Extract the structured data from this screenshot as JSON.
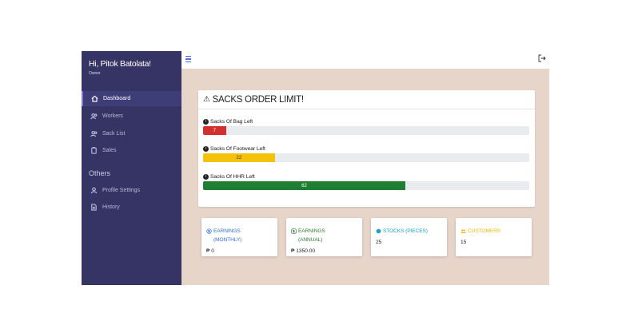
{
  "user": {
    "name": "Hi, Pitok Batolata!",
    "role": "Owner"
  },
  "sidebar": {
    "items": [
      {
        "label": "Dashboard"
      },
      {
        "label": "Workers"
      },
      {
        "label": "Sack List"
      },
      {
        "label": "Sales"
      }
    ],
    "others_label": "Others",
    "others_items": [
      {
        "label": "Profile Settings"
      },
      {
        "label": "History"
      }
    ]
  },
  "sacks": {
    "title": "SACKS ORDER LIMIT!",
    "items": [
      {
        "label": "Sacks Of Bag Left",
        "value": "7",
        "fraction": 0.07,
        "color": "#d32f2f"
      },
      {
        "label": "Sacks Of Footwear Left",
        "value": "22",
        "fraction": 0.22,
        "color": "#f4c20d"
      },
      {
        "label": "Sacks Of HHR Left",
        "value": "62",
        "fraction": 0.62,
        "color": "#1e7e34"
      }
    ]
  },
  "stats": [
    {
      "title_line1": "EARNINGS",
      "title_line2": "(MONTHLY)",
      "value": "₱ 0",
      "color": "#2f6fe0",
      "icon": "dollar-circle-icon"
    },
    {
      "title_line1": "EARNINGS",
      "title_line2": "(ANNUAL)",
      "value": "₱ 1350.00",
      "color": "#2e7d32",
      "icon": "dollar-icon"
    },
    {
      "title_line1": "STOCKS (PIECES)",
      "title_line2": "",
      "value": "25",
      "color": "#1aa3c9",
      "icon": "box-icon"
    },
    {
      "title_line1": "CUSTOMERS",
      "title_line2": "",
      "value": "15",
      "color": "#f2b705",
      "icon": "users-icon"
    }
  ],
  "colors": {
    "sidebar": "#363465",
    "main_bg": "#e8d5ca",
    "accent": "#4e6ee8"
  }
}
